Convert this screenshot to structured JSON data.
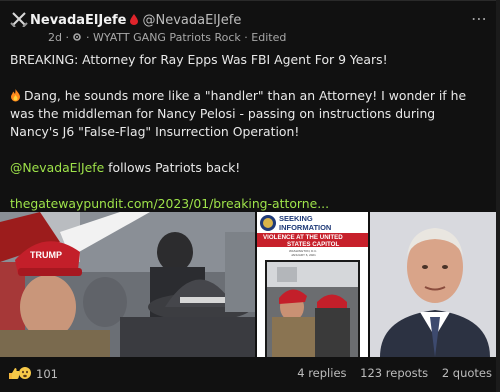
{
  "post": {
    "author_name": "NevadaElJefe",
    "author_handle": "@NevadaElJefe",
    "time_ago": "2d",
    "dot": "·",
    "group": "WYATT GANG Patriots Rock",
    "edited": "Edited",
    "headline": "BREAKING: Attorney for Ray Epps Was FBI Agent For 9 Years!",
    "body": "Dang, he sounds more like a \"handler\" than an Attorney! I wonder if he was the middleman for Nancy Pelosi - passing on instructions during Nancy's J6 \"False-Flag\" Insurrection Operation!",
    "mention": "@NevadaElJefe",
    "follows_text": " follows Patriots back!",
    "link": "thegatewaypundit.com/2023/01/breaking-attorne..."
  },
  "media": {
    "img1_text": "TRUMP",
    "img2_title_1": "SEEKING",
    "img2_title_2": "INFORMATION",
    "img2_subtitle_1": "VIOLENCE AT THE UNITED",
    "img2_subtitle_2": "STATES CAPITOL",
    "img2_small_1": "WASHINGTON, D.C.",
    "img2_small_2": "JANUARY 6, 2021"
  },
  "footer": {
    "reaction_count": "101",
    "replies": "4 replies",
    "reposts": "123 reposts",
    "quotes": "2 quotes"
  },
  "icons": {
    "more": "⋯",
    "edited_icon": "settings-icon"
  }
}
